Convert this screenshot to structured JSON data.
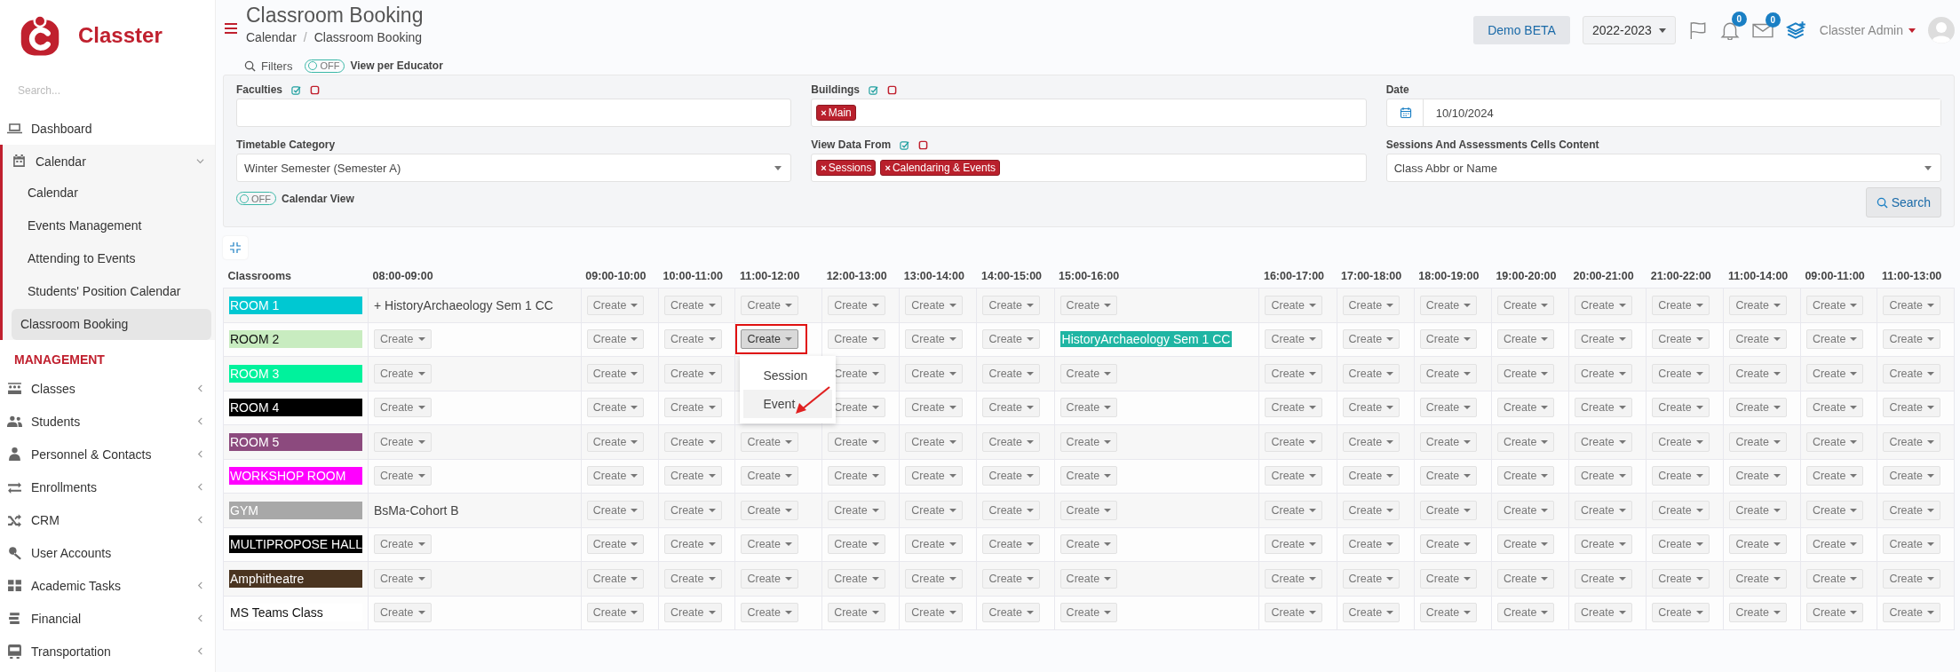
{
  "sidebar": {
    "brand": "Classter",
    "search": {
      "placeholder": "Search..."
    },
    "sections": [
      {
        "items": [
          {
            "kind": "link",
            "label": "Dashboard"
          },
          {
            "kind": "group",
            "label": "Calendar",
            "expanded": true,
            "children": [
              {
                "label": "Calendar",
                "selected": false
              },
              {
                "label": "Events Management",
                "selected": false
              },
              {
                "label": "Attending to Events",
                "selected": false
              },
              {
                "label": "Students' Position Calendar",
                "selected": false
              },
              {
                "label": "Classroom Booking",
                "selected": true
              }
            ]
          }
        ]
      },
      {
        "title": "MANAGEMENT",
        "items": [
          {
            "kind": "group",
            "label": "Classes",
            "expanded": false
          },
          {
            "kind": "group",
            "label": "Students",
            "expanded": false
          },
          {
            "kind": "group",
            "label": "Personnel & Contacts",
            "expanded": false
          },
          {
            "kind": "group",
            "label": "Enrollments",
            "expanded": false
          },
          {
            "kind": "group",
            "label": "CRM",
            "expanded": false
          },
          {
            "kind": "link",
            "label": "User Accounts"
          },
          {
            "kind": "group",
            "label": "Academic Tasks",
            "expanded": false
          },
          {
            "kind": "group",
            "label": "Financial",
            "expanded": false
          },
          {
            "kind": "group",
            "label": "Transportation",
            "expanded": false
          }
        ]
      }
    ]
  },
  "header": {
    "title": "Classroom Booking",
    "breadcrumb": {
      "items": [
        "Calendar",
        "Classroom Booking"
      ],
      "separator": "/"
    },
    "demo_button": "Demo BETA",
    "year_select": "2022-2023",
    "notifications": {
      "count": "0"
    },
    "messages": {
      "count": "0"
    },
    "user": "Classter Admin"
  },
  "filters": {
    "label": "Filters",
    "view_per_educator": {
      "on": false,
      "state_text": "OFF",
      "label": "View per Educator"
    },
    "fields": [
      {
        "kind": "multi",
        "label": "Faculties"
      },
      {
        "kind": "multi",
        "label": "Buildings",
        "tags": [
          {
            "label": "Main",
            "remove": "×"
          }
        ]
      },
      {
        "kind": "date",
        "label": "Date",
        "value": "10/10/2024"
      },
      {
        "kind": "select",
        "label": "Timetable Category",
        "value": "Winter Semester (Semester A)"
      },
      {
        "kind": "multi",
        "label": "View Data From",
        "tags": [
          {
            "label": "Sessions",
            "remove": "×"
          },
          {
            "label": "Calendaring & Events",
            "remove": "×"
          }
        ]
      },
      {
        "kind": "select",
        "label": "Sessions And Assessments Cells Content",
        "value": "Class Abbr or Name"
      }
    ],
    "calendar_view": {
      "on": false,
      "state_text": "OFF",
      "label": "Calendar View"
    },
    "search_button": "Search"
  },
  "table": {
    "row_header": "Classrooms",
    "columns": [
      "08:00-09:00",
      "09:00-10:00",
      "10:00-11:00",
      "11:00-12:00",
      "12:00-13:00",
      "13:00-14:00",
      "14:00-15:00",
      "15:00-16:00",
      "16:00-17:00",
      "17:00-18:00",
      "18:00-19:00",
      "19:00-20:00",
      "20:00-21:00",
      "21:00-22:00",
      "11:00-14:00",
      "09:00-11:00",
      "11:00-13:00"
    ],
    "rows": [
      {
        "name": "ROOM 1",
        "color": "#00c8d2",
        "cells": [
          {
            "kind": "text",
            "text": "+ HistoryArchaeology Sem 1 CC"
          },
          {
            "kind": "create",
            "text": "Create"
          },
          {
            "kind": "create",
            "text": "Create"
          },
          {
            "kind": "create",
            "text": "Create"
          },
          {
            "kind": "create",
            "text": "Create"
          },
          {
            "kind": "create",
            "text": "Create"
          },
          {
            "kind": "create",
            "text": "Create"
          },
          {
            "kind": "create",
            "text": "Create"
          },
          {
            "kind": "create",
            "text": "Create"
          },
          {
            "kind": "create",
            "text": "Create"
          },
          {
            "kind": "create",
            "text": "Create"
          },
          {
            "kind": "create",
            "text": "Create"
          },
          {
            "kind": "create",
            "text": "Create"
          },
          {
            "kind": "create",
            "text": "Create"
          },
          {
            "kind": "create",
            "text": "Create"
          },
          {
            "kind": "create",
            "text": "Create"
          },
          {
            "kind": "create",
            "text": "Create"
          }
        ]
      },
      {
        "name": "ROOM 2",
        "color": "#c8ecc0",
        "cells": [
          {
            "kind": "create",
            "text": "Create"
          },
          {
            "kind": "create",
            "text": "Create"
          },
          {
            "kind": "create",
            "text": "Create"
          },
          {
            "kind": "create_open",
            "text": "Create",
            "menu": [
              {
                "label": "Session",
                "selected": false
              },
              {
                "label": "Event",
                "selected": true
              }
            ]
          },
          {
            "kind": "create",
            "text": "Create"
          },
          {
            "kind": "create",
            "text": "Create"
          },
          {
            "kind": "create",
            "text": "Create"
          },
          {
            "kind": "event",
            "text": "HistoryArchaeology Sem 1 CC"
          },
          {
            "kind": "create",
            "text": "Create"
          },
          {
            "kind": "create",
            "text": "Create"
          },
          {
            "kind": "create",
            "text": "Create"
          },
          {
            "kind": "create",
            "text": "Create"
          },
          {
            "kind": "create",
            "text": "Create"
          },
          {
            "kind": "create",
            "text": "Create"
          },
          {
            "kind": "create",
            "text": "Create"
          },
          {
            "kind": "create",
            "text": "Create"
          },
          {
            "kind": "create",
            "text": "Create"
          }
        ]
      },
      {
        "name": "ROOM 3",
        "color": "#00f29c",
        "cells": [
          {
            "kind": "create",
            "text": "Create"
          },
          {
            "kind": "create",
            "text": "Create"
          },
          {
            "kind": "create",
            "text": "Create"
          },
          {
            "kind": "covered"
          },
          {
            "kind": "create",
            "text": "Create"
          },
          {
            "kind": "create",
            "text": "Create"
          },
          {
            "kind": "create",
            "text": "Create"
          },
          {
            "kind": "create",
            "text": "Create"
          },
          {
            "kind": "create",
            "text": "Create"
          },
          {
            "kind": "create",
            "text": "Create"
          },
          {
            "kind": "create",
            "text": "Create"
          },
          {
            "kind": "create",
            "text": "Create"
          },
          {
            "kind": "create",
            "text": "Create"
          },
          {
            "kind": "create",
            "text": "Create"
          },
          {
            "kind": "create",
            "text": "Create"
          },
          {
            "kind": "create",
            "text": "Create"
          },
          {
            "kind": "create",
            "text": "Create"
          }
        ]
      },
      {
        "name": "ROOM 4",
        "color": "#000000",
        "cells": [
          {
            "kind": "create",
            "text": "Create"
          },
          {
            "kind": "create",
            "text": "Create"
          },
          {
            "kind": "create",
            "text": "Create"
          },
          {
            "kind": "covered"
          },
          {
            "kind": "create",
            "text": "Create"
          },
          {
            "kind": "create",
            "text": "Create"
          },
          {
            "kind": "create",
            "text": "Create"
          },
          {
            "kind": "create",
            "text": "Create"
          },
          {
            "kind": "create",
            "text": "Create"
          },
          {
            "kind": "create",
            "text": "Create"
          },
          {
            "kind": "create",
            "text": "Create"
          },
          {
            "kind": "create",
            "text": "Create"
          },
          {
            "kind": "create",
            "text": "Create"
          },
          {
            "kind": "create",
            "text": "Create"
          },
          {
            "kind": "create",
            "text": "Create"
          },
          {
            "kind": "create",
            "text": "Create"
          },
          {
            "kind": "create",
            "text": "Create"
          }
        ]
      },
      {
        "name": "ROOM 5",
        "color": "#8c4a7e",
        "cells": [
          {
            "kind": "create",
            "text": "Create"
          },
          {
            "kind": "create",
            "text": "Create"
          },
          {
            "kind": "create",
            "text": "Create"
          },
          {
            "kind": "create",
            "text": "Create"
          },
          {
            "kind": "create",
            "text": "Create"
          },
          {
            "kind": "create",
            "text": "Create"
          },
          {
            "kind": "create",
            "text": "Create"
          },
          {
            "kind": "create",
            "text": "Create"
          },
          {
            "kind": "create",
            "text": "Create"
          },
          {
            "kind": "create",
            "text": "Create"
          },
          {
            "kind": "create",
            "text": "Create"
          },
          {
            "kind": "create",
            "text": "Create"
          },
          {
            "kind": "create",
            "text": "Create"
          },
          {
            "kind": "create",
            "text": "Create"
          },
          {
            "kind": "create",
            "text": "Create"
          },
          {
            "kind": "create",
            "text": "Create"
          },
          {
            "kind": "create",
            "text": "Create"
          }
        ]
      },
      {
        "name": "WORKSHOP ROOM",
        "color": "#ff00ff",
        "cells": [
          {
            "kind": "create",
            "text": "Create"
          },
          {
            "kind": "create",
            "text": "Create"
          },
          {
            "kind": "create",
            "text": "Create"
          },
          {
            "kind": "create",
            "text": "Create"
          },
          {
            "kind": "create",
            "text": "Create"
          },
          {
            "kind": "create",
            "text": "Create"
          },
          {
            "kind": "create",
            "text": "Create"
          },
          {
            "kind": "create",
            "text": "Create"
          },
          {
            "kind": "create",
            "text": "Create"
          },
          {
            "kind": "create",
            "text": "Create"
          },
          {
            "kind": "create",
            "text": "Create"
          },
          {
            "kind": "create",
            "text": "Create"
          },
          {
            "kind": "create",
            "text": "Create"
          },
          {
            "kind": "create",
            "text": "Create"
          },
          {
            "kind": "create",
            "text": "Create"
          },
          {
            "kind": "create",
            "text": "Create"
          },
          {
            "kind": "create",
            "text": "Create"
          }
        ]
      },
      {
        "name": "GYM",
        "color": "#a8a8a8",
        "cells": [
          {
            "kind": "text",
            "text": "BsMa-Cohort B"
          },
          {
            "kind": "create",
            "text": "Create"
          },
          {
            "kind": "create",
            "text": "Create"
          },
          {
            "kind": "create",
            "text": "Create"
          },
          {
            "kind": "create",
            "text": "Create"
          },
          {
            "kind": "create",
            "text": "Create"
          },
          {
            "kind": "create",
            "text": "Create"
          },
          {
            "kind": "create",
            "text": "Create"
          },
          {
            "kind": "create",
            "text": "Create"
          },
          {
            "kind": "create",
            "text": "Create"
          },
          {
            "kind": "create",
            "text": "Create"
          },
          {
            "kind": "create",
            "text": "Create"
          },
          {
            "kind": "create",
            "text": "Create"
          },
          {
            "kind": "create",
            "text": "Create"
          },
          {
            "kind": "create",
            "text": "Create"
          },
          {
            "kind": "create",
            "text": "Create"
          },
          {
            "kind": "create",
            "text": "Create"
          }
        ]
      },
      {
        "name": "MULTIPROPOSE HALL",
        "color": "#000000",
        "cells": [
          {
            "kind": "create",
            "text": "Create"
          },
          {
            "kind": "create",
            "text": "Create"
          },
          {
            "kind": "create",
            "text": "Create"
          },
          {
            "kind": "create",
            "text": "Create"
          },
          {
            "kind": "create",
            "text": "Create"
          },
          {
            "kind": "create",
            "text": "Create"
          },
          {
            "kind": "create",
            "text": "Create"
          },
          {
            "kind": "create",
            "text": "Create"
          },
          {
            "kind": "create",
            "text": "Create"
          },
          {
            "kind": "create",
            "text": "Create"
          },
          {
            "kind": "create",
            "text": "Create"
          },
          {
            "kind": "create",
            "text": "Create"
          },
          {
            "kind": "create",
            "text": "Create"
          },
          {
            "kind": "create",
            "text": "Create"
          },
          {
            "kind": "create",
            "text": "Create"
          },
          {
            "kind": "create",
            "text": "Create"
          },
          {
            "kind": "create",
            "text": "Create"
          }
        ]
      },
      {
        "name": "Amphitheatre",
        "color": "#4a3420",
        "cells": [
          {
            "kind": "create",
            "text": "Create"
          },
          {
            "kind": "create",
            "text": "Create"
          },
          {
            "kind": "create",
            "text": "Create"
          },
          {
            "kind": "create",
            "text": "Create"
          },
          {
            "kind": "create",
            "text": "Create"
          },
          {
            "kind": "create",
            "text": "Create"
          },
          {
            "kind": "create",
            "text": "Create"
          },
          {
            "kind": "create",
            "text": "Create"
          },
          {
            "kind": "create",
            "text": "Create"
          },
          {
            "kind": "create",
            "text": "Create"
          },
          {
            "kind": "create",
            "text": "Create"
          },
          {
            "kind": "create",
            "text": "Create"
          },
          {
            "kind": "create",
            "text": "Create"
          },
          {
            "kind": "create",
            "text": "Create"
          },
          {
            "kind": "create",
            "text": "Create"
          },
          {
            "kind": "create",
            "text": "Create"
          },
          {
            "kind": "create",
            "text": "Create"
          }
        ]
      },
      {
        "name": "MS Teams Class",
        "color": "#ffffff",
        "cells": [
          {
            "kind": "create",
            "text": "Create"
          },
          {
            "kind": "create",
            "text": "Create"
          },
          {
            "kind": "create",
            "text": "Create"
          },
          {
            "kind": "create",
            "text": "Create"
          },
          {
            "kind": "create",
            "text": "Create"
          },
          {
            "kind": "create",
            "text": "Create"
          },
          {
            "kind": "create",
            "text": "Create"
          },
          {
            "kind": "create",
            "text": "Create"
          },
          {
            "kind": "create",
            "text": "Create"
          },
          {
            "kind": "create",
            "text": "Create"
          },
          {
            "kind": "create",
            "text": "Create"
          },
          {
            "kind": "create",
            "text": "Create"
          },
          {
            "kind": "create",
            "text": "Create"
          },
          {
            "kind": "create",
            "text": "Create"
          },
          {
            "kind": "create",
            "text": "Create"
          },
          {
            "kind": "create",
            "text": "Create"
          },
          {
            "kind": "create",
            "text": "Create"
          }
        ]
      }
    ]
  }
}
